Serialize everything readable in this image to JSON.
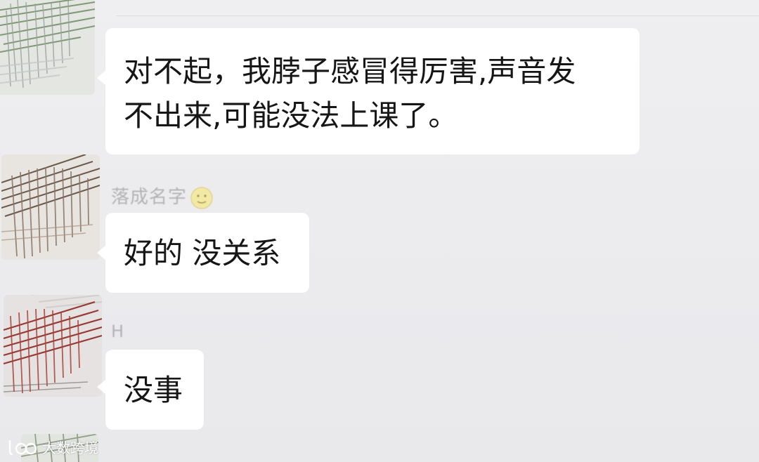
{
  "chat": {
    "messages": [
      {
        "sender": "",
        "text": "对不起，我脖子感冒得厉害,声音发\n不出来,可能没法上课了。"
      },
      {
        "sender": "落成名字",
        "sender_emoji": "full-moon-face-emoji",
        "text": "好的 没关系"
      },
      {
        "sender": "H",
        "text": "没事"
      }
    ]
  },
  "watermark": {
    "text": "大数跨境",
    "icon": "brand-logo-icon"
  },
  "colors": {
    "background": "#ececef",
    "bubble": "#ffffff",
    "text": "#161616",
    "sender_name": "#b3b3b7"
  }
}
